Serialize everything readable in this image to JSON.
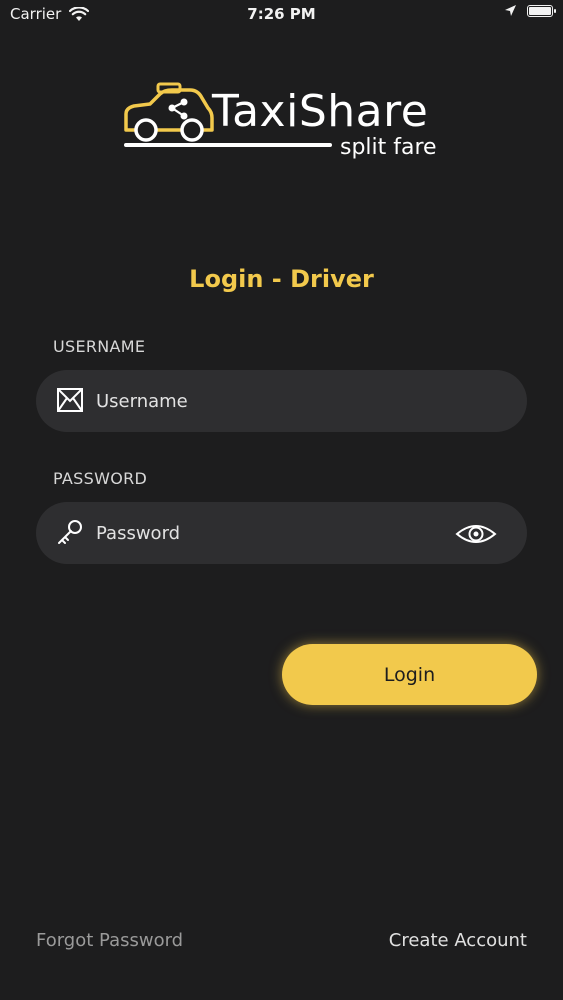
{
  "status_bar": {
    "carrier": "Carrier",
    "time": "7:26 PM",
    "icons": [
      "wifi-icon",
      "location-arrow-icon",
      "battery-icon"
    ]
  },
  "brand": {
    "name": "TaxiShare",
    "tagline": "split fare",
    "accent_color": "#f2c94c",
    "logo_icon": "taxi-share-icon"
  },
  "page": {
    "title": "Login - Driver"
  },
  "form": {
    "username": {
      "label": "USERNAME",
      "placeholder": "Username",
      "value": "",
      "icon": "envelope-icon"
    },
    "password": {
      "label": "PASSWORD",
      "placeholder": "Password",
      "value": "",
      "icon": "key-icon",
      "toggle_icon": "eye-icon"
    },
    "submit_label": "Login"
  },
  "footer": {
    "forgot_password": "Forgot Password",
    "create_account": "Create Account"
  }
}
